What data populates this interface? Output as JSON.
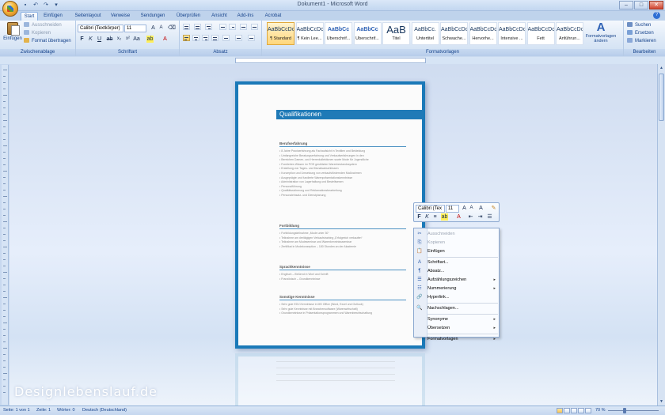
{
  "window": {
    "title": "Dokument1 - Microsoft Word"
  },
  "tabs": [
    {
      "label": "Start",
      "active": true
    },
    {
      "label": "Einfügen"
    },
    {
      "label": "Seitenlayout"
    },
    {
      "label": "Verweise"
    },
    {
      "label": "Sendungen"
    },
    {
      "label": "Überprüfen"
    },
    {
      "label": "Ansicht"
    },
    {
      "label": "Add-Ins"
    },
    {
      "label": "Acrobat"
    }
  ],
  "ribbon": {
    "clipboard": {
      "label": "Zwischenablage",
      "paste": "Einfügen",
      "cut": "Ausschneiden",
      "copy": "Kopieren",
      "format_painter": "Format übertragen"
    },
    "font": {
      "label": "Schriftart",
      "name": "Calibri (Textkörper)",
      "size": "11"
    },
    "paragraph": {
      "label": "Absatz"
    },
    "styles": {
      "label": "Formatvorlagen",
      "items": [
        {
          "sample": "AaBbCcDc",
          "name": "¶ Standard"
        },
        {
          "sample": "AaBbCcDc",
          "name": "¶ Kein Lee..."
        },
        {
          "sample": "AaBbCc",
          "name": "Überschrif..."
        },
        {
          "sample": "AaBbCc",
          "name": "Überschrif..."
        },
        {
          "sample": "AaB",
          "name": "Titel"
        },
        {
          "sample": "AaBbCc.",
          "name": "Untertitel"
        },
        {
          "sample": "AaBbCcDc",
          "name": "Schwache..."
        },
        {
          "sample": "AaBbCcDc",
          "name": "Hervorhe..."
        },
        {
          "sample": "AaBbCcDc",
          "name": "Intensive ..."
        },
        {
          "sample": "AaBbCcDc",
          "name": "Fett"
        },
        {
          "sample": "AaBbCcDc",
          "name": "Anführun..."
        }
      ],
      "change_styles": "Formatvorlagen ändern"
    },
    "editing": {
      "label": "Bearbeiten",
      "find": "Suchen",
      "replace": "Ersetzen",
      "select": "Markieren"
    }
  },
  "document": {
    "heading": "Qualifikationen",
    "sections": [
      {
        "title": "Berufserfahrung",
        "lines": [
          "8 Jahre Praxiserfahrung als Fachaufsicht in Textilien und Bekleidung",
          "Umfangreiche Beratungserfahrung und Verkaufserfahrungen in den",
          "Bereichen Damen- und Herrenkollektionen sowie Mode für Jugendliche",
          "Fundiertes Wissen im POS gestützten Warenbestandssystem",
          "Erstellung von Tages- und Monatsabschlüssen",
          "Konzeption und Umsetzung von verkaufsfördernden Maßnahmen",
          "Ausgeprägte und fundierte Warenpräsentationskenntnisse",
          "Administration von Lagerhaltung und Bestellwesen",
          "Personalführung",
          "Qualitätssicherung und Reklamationsbearbeitung",
          "Personaleinsatz- und Dienstplanung"
        ]
      },
      {
        "title": "Fortbildung",
        "lines": [
          "Fortbildungsteilnahme „Mode unter 30“",
          "Teilnahme am dreitägigen Verkaufstraining „Erfolgreich verkaufen“",
          "Teilnahme am Modeseminar und Warenkenntnissseminar",
          "Zertifikat in Modekonzeption – 180 Stunden an der Akademie"
        ]
      },
      {
        "title": "Sprachkenntnisse",
        "lines": [
          "Englisch – fließend in Wort und Schrift",
          "Französisch – Grundkenntnisse"
        ]
      },
      {
        "title": "Sonstige Kenntnisse",
        "lines": [
          "Sehr gute EDV-Kenntnisse in MS Office (Word, Excel und Outlook)",
          "Sehr gute Kenntnisse mit Branchensoftware (Warenwirtschaft)",
          "Grundkenntnisse in Präsentationsprogrammen und Warenbewirtschaftung"
        ]
      }
    ]
  },
  "mini_toolbar": {
    "font": "Calibri (Tex",
    "size": "11"
  },
  "context_menu": [
    {
      "label": "Ausschneiden",
      "icon": "scissors-icon",
      "disabled": true
    },
    {
      "label": "Kopieren",
      "icon": "copy-icon",
      "disabled": true
    },
    {
      "label": "Einfügen",
      "icon": "paste-icon"
    },
    {
      "separator": true
    },
    {
      "label": "Schriftart...",
      "icon": "font-icon"
    },
    {
      "label": "Absatz...",
      "icon": "paragraph-icon"
    },
    {
      "label": "Aufzählungszeichen",
      "icon": "bullets-icon",
      "submenu": true
    },
    {
      "label": "Nummerierung",
      "icon": "numbering-icon",
      "submenu": true
    },
    {
      "label": "Hyperlink...",
      "icon": "hyperlink-icon"
    },
    {
      "separator": true
    },
    {
      "label": "Nachschlagen...",
      "icon": "lookup-icon"
    },
    {
      "separator": true
    },
    {
      "label": "Synonyme",
      "submenu": true
    },
    {
      "label": "Übersetzen",
      "submenu": true
    },
    {
      "separator": true
    },
    {
      "label": "Formatvorlagen",
      "submenu": true
    }
  ],
  "statusbar": {
    "page": "Seite: 1 von 1",
    "line": "Zeile: 1",
    "words": "Wörter: 0",
    "language": "Deutsch (Deutschland)",
    "zoom": "70 %"
  },
  "watermark": "Designlebenslauf.de",
  "colors": {
    "accent": "#1f7ab7",
    "ribbon": "#dce8f6"
  }
}
